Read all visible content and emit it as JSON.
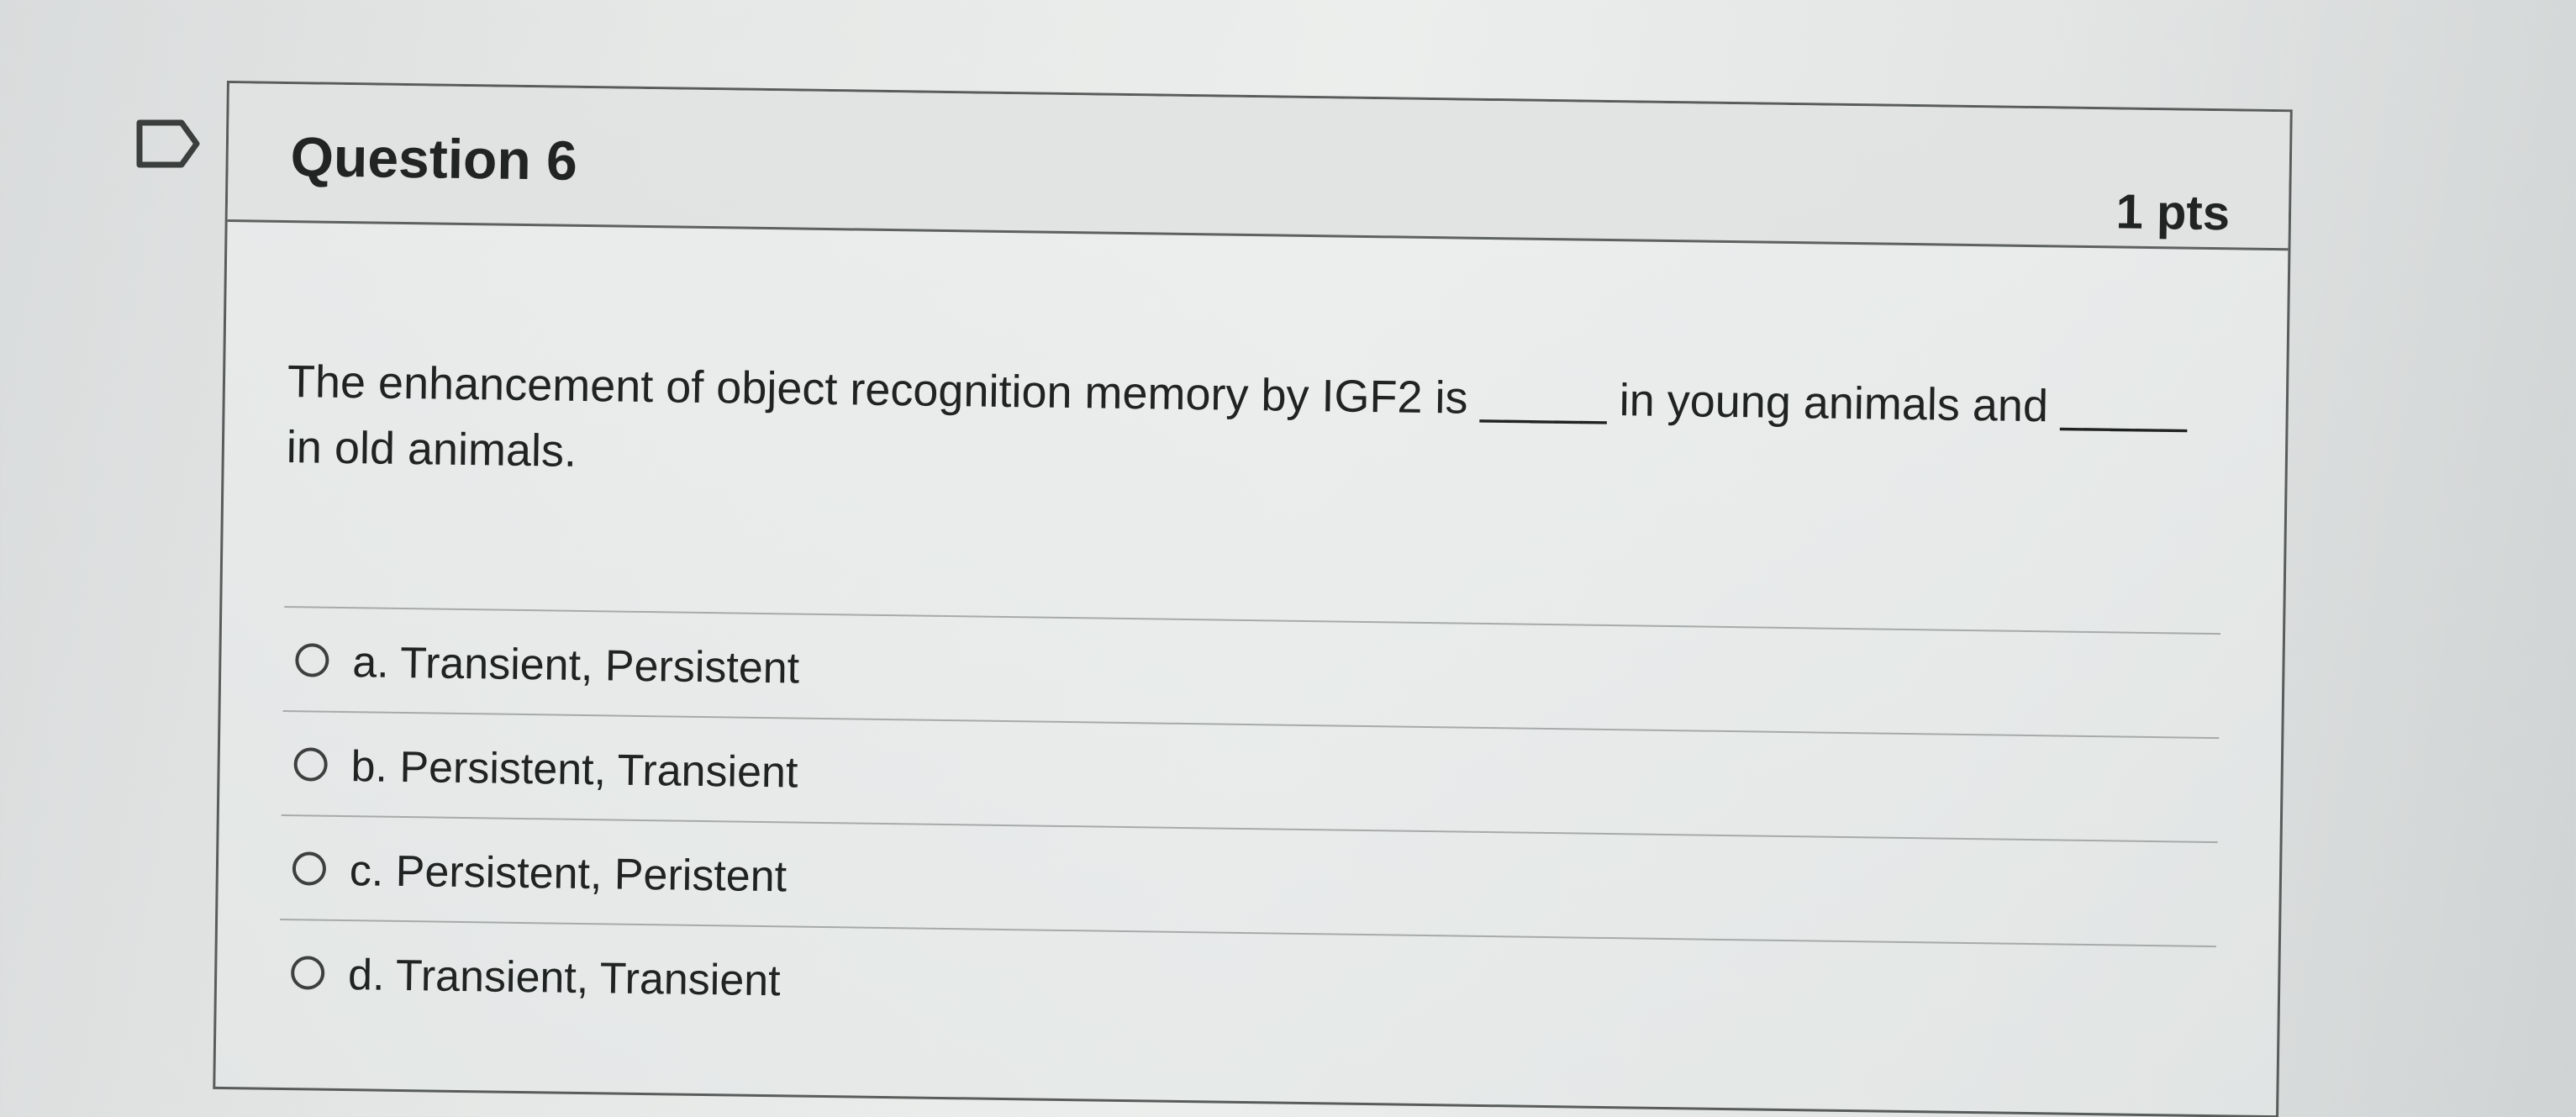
{
  "question": {
    "title": "Question 6",
    "points": "1 pts",
    "text": "The enhancement of object recognition memory by IGF2 is _____ in young animals and _____ in old animals."
  },
  "answers": [
    {
      "label": "a. Transient, Persistent"
    },
    {
      "label": "b. Persistent, Transient"
    },
    {
      "label": "c. Persistent, Peristent"
    },
    {
      "label": "d. Transient, Transient"
    }
  ],
  "icons": {
    "flag": "flag-icon"
  }
}
